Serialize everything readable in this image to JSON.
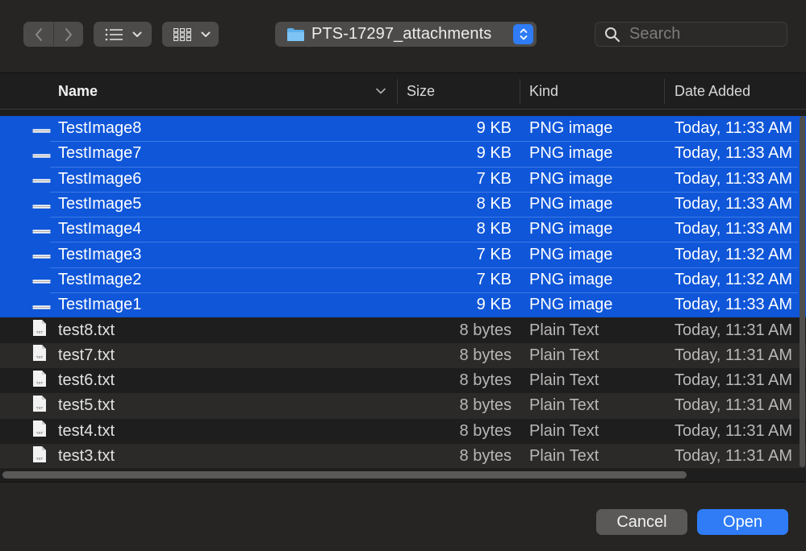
{
  "toolbar": {
    "path_label": "PTS-17297_attachments",
    "search_placeholder": "Search"
  },
  "columns": {
    "name": "Name",
    "size": "Size",
    "kind": "Kind",
    "date": "Date Added"
  },
  "files": [
    {
      "name": "TestImage8",
      "size": "9 KB",
      "kind": "PNG image",
      "date": "Today, 11:33 AM",
      "type": "image",
      "selected": true
    },
    {
      "name": "TestImage7",
      "size": "9 KB",
      "kind": "PNG image",
      "date": "Today, 11:33 AM",
      "type": "image",
      "selected": true
    },
    {
      "name": "TestImage6",
      "size": "7 KB",
      "kind": "PNG image",
      "date": "Today, 11:33 AM",
      "type": "image",
      "selected": true
    },
    {
      "name": "TestImage5",
      "size": "8 KB",
      "kind": "PNG image",
      "date": "Today, 11:33 AM",
      "type": "image",
      "selected": true
    },
    {
      "name": "TestImage4",
      "size": "8 KB",
      "kind": "PNG image",
      "date": "Today, 11:33 AM",
      "type": "image",
      "selected": true
    },
    {
      "name": "TestImage3",
      "size": "7 KB",
      "kind": "PNG image",
      "date": "Today, 11:32 AM",
      "type": "image",
      "selected": true
    },
    {
      "name": "TestImage2",
      "size": "7 KB",
      "kind": "PNG image",
      "date": "Today, 11:32 AM",
      "type": "image",
      "selected": true
    },
    {
      "name": "TestImage1",
      "size": "9 KB",
      "kind": "PNG image",
      "date": "Today, 11:33 AM",
      "type": "image",
      "selected": true
    },
    {
      "name": "test8.txt",
      "size": "8 bytes",
      "kind": "Plain Text",
      "date": "Today, 11:31 AM",
      "type": "text",
      "selected": false
    },
    {
      "name": "test7.txt",
      "size": "8 bytes",
      "kind": "Plain Text",
      "date": "Today, 11:31 AM",
      "type": "text",
      "selected": false
    },
    {
      "name": "test6.txt",
      "size": "8 bytes",
      "kind": "Plain Text",
      "date": "Today, 11:31 AM",
      "type": "text",
      "selected": false
    },
    {
      "name": "test5.txt",
      "size": "8 bytes",
      "kind": "Plain Text",
      "date": "Today, 11:31 AM",
      "type": "text",
      "selected": false
    },
    {
      "name": "test4.txt",
      "size": "8 bytes",
      "kind": "Plain Text",
      "date": "Today, 11:31 AM",
      "type": "text",
      "selected": false
    },
    {
      "name": "test3.txt",
      "size": "8 bytes",
      "kind": "Plain Text",
      "date": "Today, 11:31 AM",
      "type": "text",
      "selected": false
    }
  ],
  "file_icon_text": "TXT",
  "footer": {
    "cancel_label": "Cancel",
    "open_label": "Open"
  },
  "colors": {
    "selection": "#0f56d9",
    "accent": "#2f7cf6"
  },
  "icons": {
    "back": "chevron-left-icon",
    "forward": "chevron-right-icon",
    "list_view": "list-view-icon",
    "grid_view": "grid-view-icon",
    "folder": "folder-icon",
    "search": "search-icon",
    "image_file": "image-file-icon",
    "text_file": "text-file-icon"
  }
}
